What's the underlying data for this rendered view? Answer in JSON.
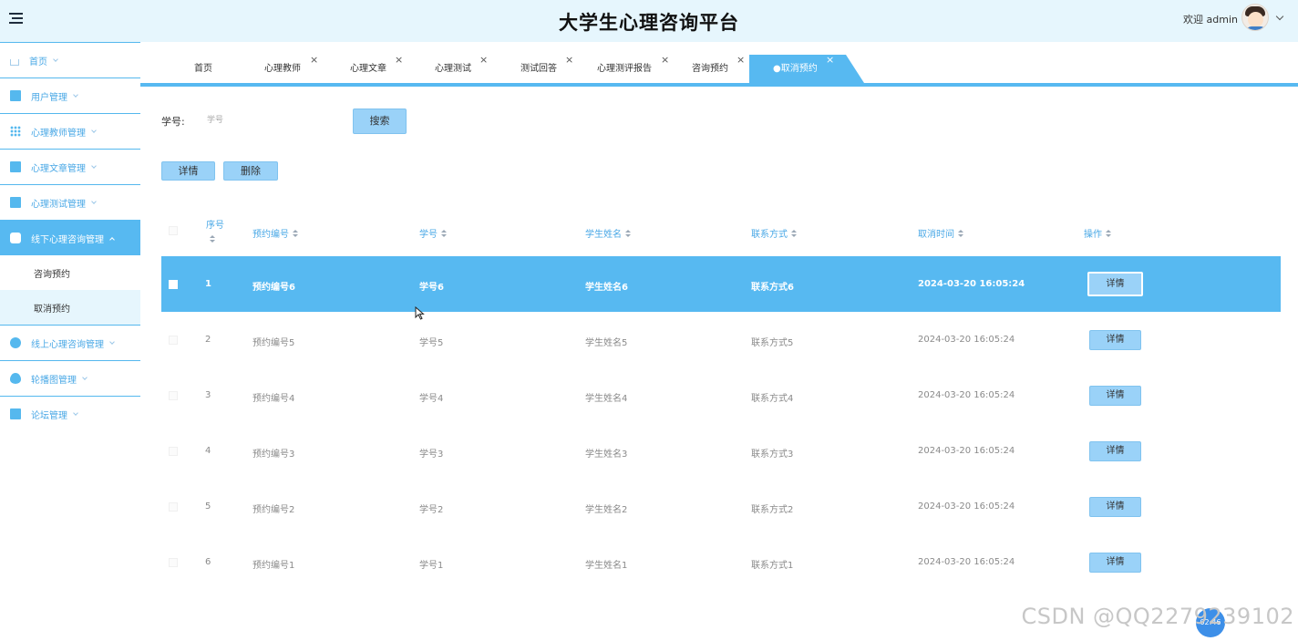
{
  "header": {
    "title": "大学生心理咨询平台",
    "welcome": "欢迎 admin"
  },
  "sidebar": {
    "items": [
      {
        "label": "首页",
        "icon": "home-icon"
      },
      {
        "label": "用户管理",
        "icon": "user-card-icon"
      },
      {
        "label": "心理教师管理",
        "icon": "grid-icon"
      },
      {
        "label": "心理文章管理",
        "icon": "briefcase-icon"
      },
      {
        "label": "心理测试管理",
        "icon": "book-icon"
      },
      {
        "label": "线下心理咨询管理",
        "icon": "apps-icon"
      },
      {
        "label": "线上心理咨询管理",
        "icon": "more-circle-icon"
      },
      {
        "label": "轮播图管理",
        "icon": "drop-icon"
      },
      {
        "label": "论坛管理",
        "icon": "crop-icon"
      }
    ],
    "subitems": [
      {
        "label": "咨询预约"
      },
      {
        "label": "取消预约"
      }
    ]
  },
  "tabs": [
    {
      "label": "首页"
    },
    {
      "label": "心理教师"
    },
    {
      "label": "心理文章"
    },
    {
      "label": "心理测试"
    },
    {
      "label": "测试回答"
    },
    {
      "label": "心理测评报告"
    },
    {
      "label": "咨询预约"
    },
    {
      "label": "●取消预约"
    }
  ],
  "tab_close": "×",
  "search": {
    "label": "学号:",
    "placeholder": "学号",
    "button": "搜索"
  },
  "actions": {
    "detail": "详情",
    "delete": "删除"
  },
  "table": {
    "columns": [
      "序号",
      "预约编号",
      "学号",
      "学生姓名",
      "联系方式",
      "取消时间",
      "操作"
    ],
    "rows": [
      {
        "seq": "1",
        "booking_no": "预约编号6",
        "student_id": "学号6",
        "name": "学生姓名6",
        "contact": "联系方式6",
        "cancel_time": "2024-03-20 16:05:24",
        "op": "详情"
      },
      {
        "seq": "2",
        "booking_no": "预约编号5",
        "student_id": "学号5",
        "name": "学生姓名5",
        "contact": "联系方式5",
        "cancel_time": "2024-03-20 16:05:24",
        "op": "详情"
      },
      {
        "seq": "3",
        "booking_no": "预约编号4",
        "student_id": "学号4",
        "name": "学生姓名4",
        "contact": "联系方式4",
        "cancel_time": "2024-03-20 16:05:24",
        "op": "详情"
      },
      {
        "seq": "4",
        "booking_no": "预约编号3",
        "student_id": "学号3",
        "name": "学生姓名3",
        "contact": "联系方式3",
        "cancel_time": "2024-03-20 16:05:24",
        "op": "详情"
      },
      {
        "seq": "5",
        "booking_no": "预约编号2",
        "student_id": "学号2",
        "name": "学生姓名2",
        "contact": "联系方式2",
        "cancel_time": "2024-03-20 16:05:24",
        "op": "详情"
      },
      {
        "seq": "6",
        "booking_no": "预约编号1",
        "student_id": "学号1",
        "name": "学生姓名1",
        "contact": "联系方式1",
        "cancel_time": "2024-03-20 16:05:24",
        "op": "详情"
      }
    ],
    "selected_row": 0
  },
  "watermark": "CSDN @QQ2279239102",
  "badge": "02:46",
  "colors": {
    "accent": "#57b9f1",
    "header_bg": "#e6f6fd",
    "button_bg": "#9ad2f8"
  }
}
